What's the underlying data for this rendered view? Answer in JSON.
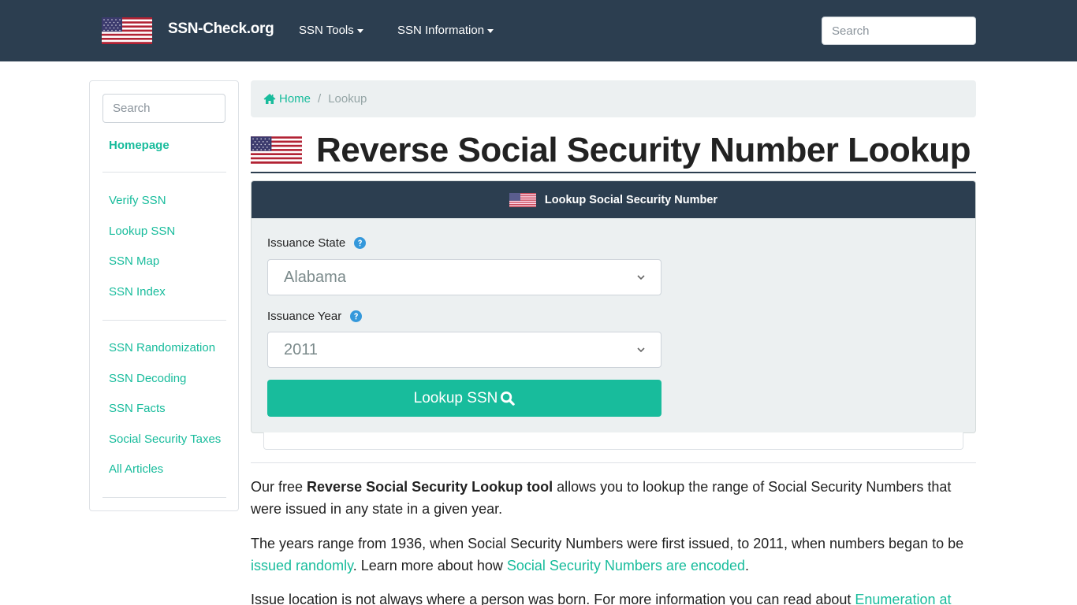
{
  "navbar": {
    "brand": "SSN-Check.org",
    "menus": [
      {
        "label": "SSN Tools"
      },
      {
        "label": "SSN Information"
      }
    ],
    "search_placeholder": "Search"
  },
  "sidebar": {
    "search_placeholder": "Search",
    "homepage": "Homepage",
    "group1": [
      {
        "label": "Verify SSN"
      },
      {
        "label": "Lookup SSN"
      },
      {
        "label": "SSN Map"
      },
      {
        "label": "SSN Index"
      }
    ],
    "group2": [
      {
        "label": "SSN Randomization"
      },
      {
        "label": "SSN Decoding"
      },
      {
        "label": "SSN Facts"
      },
      {
        "label": "Social Security Taxes"
      },
      {
        "label": "All Articles"
      }
    ]
  },
  "breadcrumb": {
    "home": "Home",
    "separator": "/",
    "current": "Lookup"
  },
  "page": {
    "title": "Reverse Social Security Number Lookup"
  },
  "lookup_card": {
    "header": "Lookup Social Security Number",
    "state_label": "Issuance State",
    "state_value": "Alabama",
    "year_label": "Issuance Year",
    "year_value": "2011",
    "button_label": "Lookup SSN"
  },
  "content": {
    "p1_pre": "Our free ",
    "p1_bold": "Reverse Social Security Lookup tool",
    "p1_post": " allows you to lookup the range of Social Security Numbers that were issued in any state in a given year.",
    "p2_pre": "The years range from 1936, when Social Security Numbers were first issued, to 2011, when numbers began to be ",
    "p2_link1": "issued randomly",
    "p2_mid": ". Learn more about how ",
    "p2_link2": "Social Security Numbers are encoded",
    "p2_post": ".",
    "p3_pre": "Issue location is not always where a person was born. For more information you can read about ",
    "p3_link": "Enumeration at"
  },
  "colors": {
    "navbar": "#2c3e50",
    "accent": "#18bc9c",
    "help_icon": "#3498db",
    "panel": "#ecf0f1"
  }
}
